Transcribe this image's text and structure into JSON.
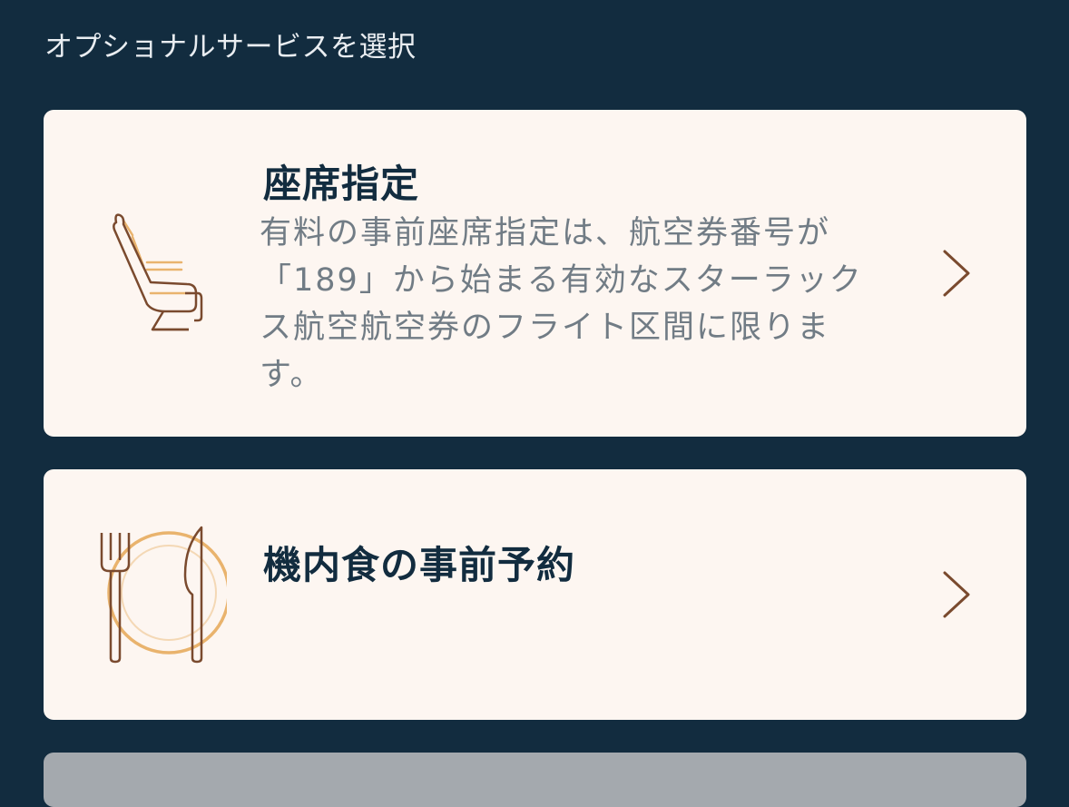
{
  "header": {
    "title": "オプショナルサービスを選択"
  },
  "services": [
    {
      "title": "座席指定",
      "description": "有料の事前座席指定は、航空券番号が「189」から始まる有効なスターラックス航空航空券のフライト区間に限ります。",
      "icon": "seat-icon"
    },
    {
      "title": "機内食の事前予約",
      "icon": "meal-icon"
    }
  ],
  "colors": {
    "background": "#122c3f",
    "card": "#fdf6f1",
    "icon_brown": "#7a4a2e",
    "icon_gold": "#e9b36d",
    "title_text": "#122c3f",
    "body_text": "#717c85"
  }
}
